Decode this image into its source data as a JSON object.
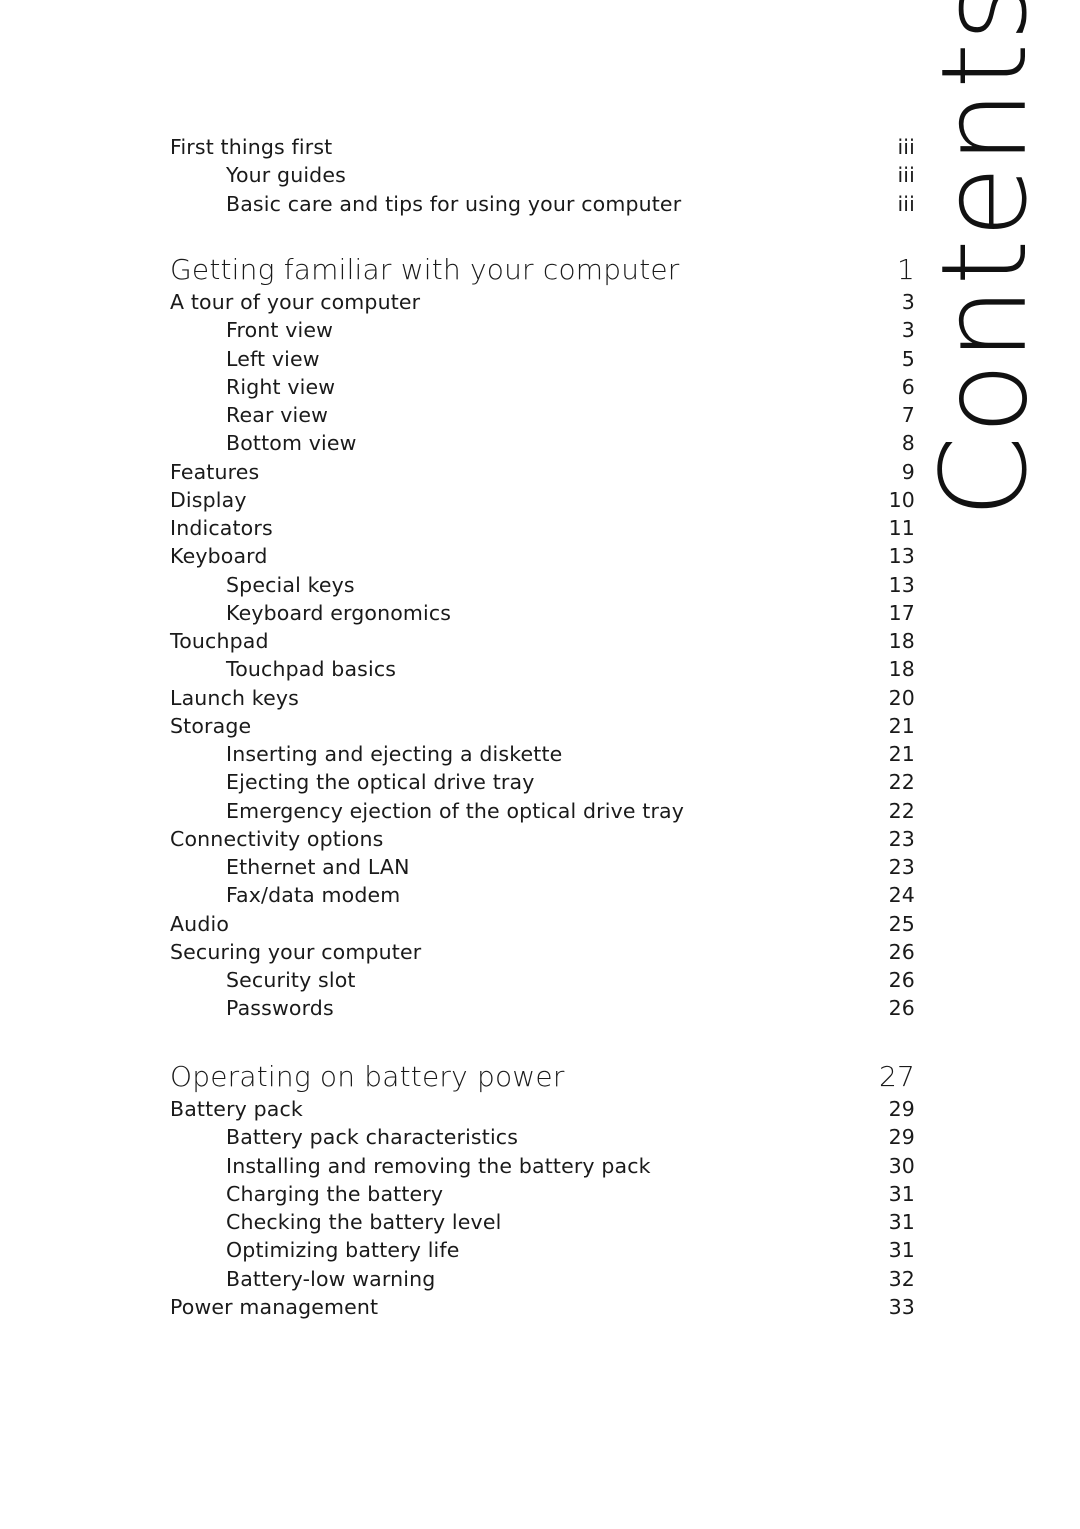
{
  "page_title": "Contents",
  "front_matter": [
    {
      "label": "First things first",
      "page": "iii",
      "level": 1
    },
    {
      "label": "Your guides",
      "page": "iii",
      "level": 2
    },
    {
      "label": "Basic care and tips for using your computer",
      "page": "iii",
      "level": 2
    }
  ],
  "chapters": [
    {
      "title": "Getting familiar with your computer",
      "page": "1",
      "entries": [
        {
          "label": "A tour of your computer",
          "page": "3",
          "level": 1
        },
        {
          "label": "Front view",
          "page": "3",
          "level": 2
        },
        {
          "label": "Left view",
          "page": "5",
          "level": 2
        },
        {
          "label": "Right view",
          "page": "6",
          "level": 2
        },
        {
          "label": "Rear view",
          "page": "7",
          "level": 2
        },
        {
          "label": "Bottom view",
          "page": "8",
          "level": 2
        },
        {
          "label": "Features",
          "page": "9",
          "level": 1
        },
        {
          "label": "Display",
          "page": "10",
          "level": 1
        },
        {
          "label": "Indicators",
          "page": "11",
          "level": 1
        },
        {
          "label": "Keyboard",
          "page": "13",
          "level": 1
        },
        {
          "label": "Special keys",
          "page": "13",
          "level": 2
        },
        {
          "label": "Keyboard ergonomics",
          "page": "17",
          "level": 2
        },
        {
          "label": "Touchpad",
          "page": "18",
          "level": 1
        },
        {
          "label": "Touchpad basics",
          "page": "18",
          "level": 2
        },
        {
          "label": "Launch keys",
          "page": "20",
          "level": 1
        },
        {
          "label": "Storage",
          "page": "21",
          "level": 1
        },
        {
          "label": "Inserting and ejecting a diskette",
          "page": "21",
          "level": 2
        },
        {
          "label": "Ejecting the optical drive tray",
          "page": "22",
          "level": 2
        },
        {
          "label": "Emergency ejection of the optical drive tray",
          "page": "22",
          "level": 2
        },
        {
          "label": "Connectivity options",
          "page": "23",
          "level": 1
        },
        {
          "label": "Ethernet and LAN",
          "page": "23",
          "level": 2
        },
        {
          "label": "Fax/data modem",
          "page": "24",
          "level": 2
        },
        {
          "label": "Audio",
          "page": "25",
          "level": 1
        },
        {
          "label": "Securing your computer",
          "page": "26",
          "level": 1
        },
        {
          "label": "Security slot",
          "page": "26",
          "level": 2
        },
        {
          "label": "Passwords",
          "page": "26",
          "level": 2
        }
      ]
    },
    {
      "title": "Operating on battery power",
      "page": "27",
      "entries": [
        {
          "label": "Battery pack",
          "page": "29",
          "level": 1
        },
        {
          "label": "Battery pack characteristics",
          "page": "29",
          "level": 2
        },
        {
          "label": "Installing and removing the battery pack",
          "page": "30",
          "level": 2
        },
        {
          "label": "Charging the battery",
          "page": "31",
          "level": 2
        },
        {
          "label": "Checking the battery level",
          "page": "31",
          "level": 2
        },
        {
          "label": "Optimizing battery life",
          "page": "31",
          "level": 2
        },
        {
          "label": "Battery-low warning",
          "page": "32",
          "level": 2
        },
        {
          "label": "Power management",
          "page": "33",
          "level": 1
        }
      ]
    }
  ]
}
